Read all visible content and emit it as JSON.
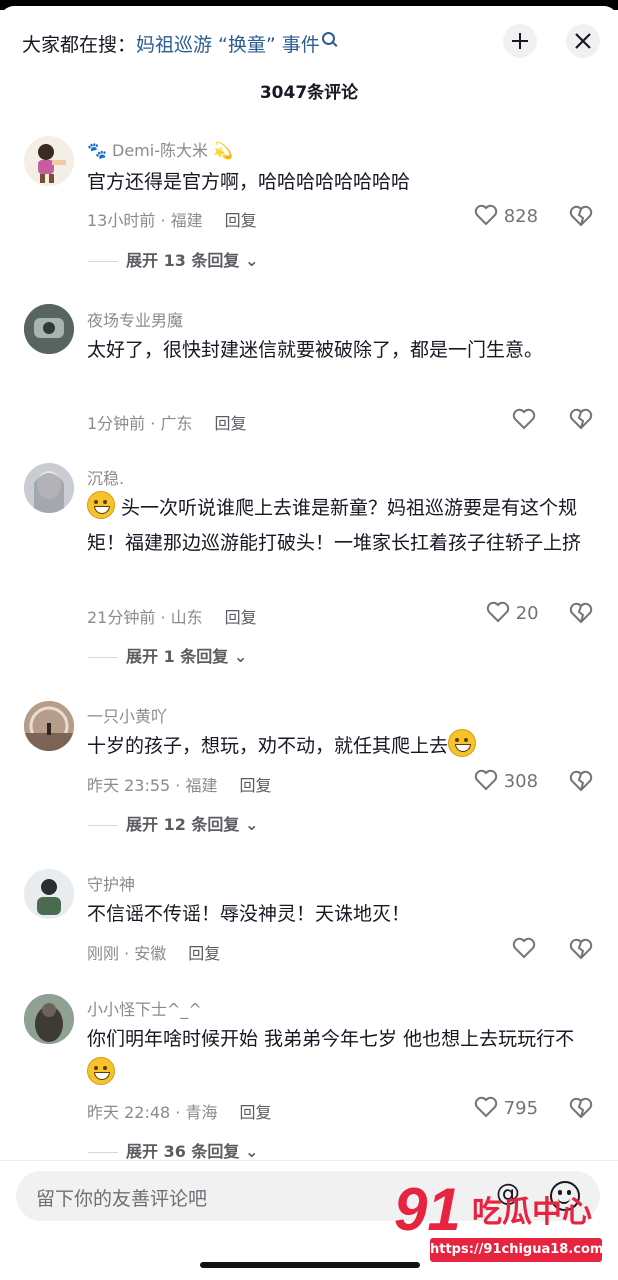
{
  "header": {
    "search_prefix": "大家都在搜：",
    "search_keyword": "妈祖巡游 “换童” 事件",
    "comment_count": "3047条评论"
  },
  "comments": [
    {
      "user": "Demi-陈大米",
      "text": "官方还得是官方啊，哈哈哈哈哈哈哈哈",
      "time": "13小时前 · 福建",
      "reply": "回复",
      "likes": "828",
      "expand": "展开 13 条回复"
    },
    {
      "user": "夜场专业男魔",
      "text": "太好了，很快封建迷信就要被破除了，都是一门生意。",
      "time": "1分钟前 · 广东",
      "reply": "回复",
      "likes": "",
      "expand": ""
    },
    {
      "user": "沉稳.",
      "text": "头一次听说谁爬上去谁是新童？妈祖巡游要是有这个规矩！福建那边巡游能打破头！一堆家长扛着孩子往轿子上挤",
      "time": "21分钟前 · 山东",
      "reply": "回复",
      "likes": "20",
      "expand": "展开 1 条回复"
    },
    {
      "user": "一只小黄吖",
      "text": "十岁的孩子，想玩，劝不动，就任其爬上去",
      "time": "昨天 23:55 · 福建",
      "reply": "回复",
      "likes": "308",
      "expand": "展开 12 条回复"
    },
    {
      "user": "守护神",
      "text": "不信谣不传谣！辱没神灵！天诛地灭！",
      "time": "刚刚 · 安徽",
      "reply": "回复",
      "likes": "",
      "expand": ""
    },
    {
      "user": "小小怪下士^_^",
      "text": "你们明年啥时候开始  我弟弟今年七岁  他也想上去玩玩行不",
      "time": "昨天 22:48 · 青海",
      "reply": "回复",
      "likes": "795",
      "expand": "展开 36 条回复"
    }
  ],
  "input": {
    "placeholder": "留下你的友善评论吧",
    "at_symbol": "@"
  },
  "watermark": {
    "logo_text": "91吃瓜中心",
    "url": "https://91chigua18.com"
  },
  "icons": {
    "like": "heart-outline-icon",
    "dislike": "broken-heart-icon",
    "emoji": "smile-icon"
  }
}
